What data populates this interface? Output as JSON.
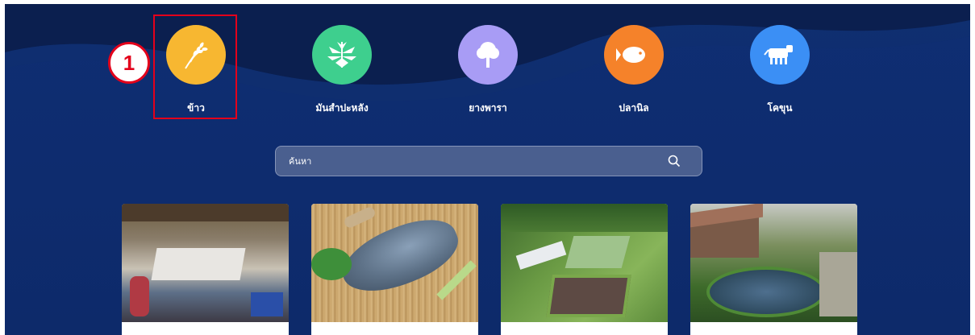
{
  "categories": [
    {
      "label": "ข้าว",
      "icon": "rice-icon",
      "color": "#f7b731"
    },
    {
      "label": "มันสำปะหลัง",
      "icon": "cassava-icon",
      "color": "#3ecf8e"
    },
    {
      "label": "ยางพารา",
      "icon": "rubber-tree-icon",
      "color": "#a89cf5"
    },
    {
      "label": "ปลานิล",
      "icon": "fish-icon",
      "color": "#f5822a"
    },
    {
      "label": "โคขุน",
      "icon": "cow-icon",
      "color": "#3b8ff5"
    }
  ],
  "annotation": {
    "step": "1"
  },
  "search": {
    "placeholder": "ค้นหา",
    "icon": "search-icon"
  },
  "cards": [
    {
      "name": "fish-market-photo"
    },
    {
      "name": "tilapia-fish-photo"
    },
    {
      "name": "fish-farm-aerial-photo"
    },
    {
      "name": "pond-farmhouse-photo"
    }
  ]
}
